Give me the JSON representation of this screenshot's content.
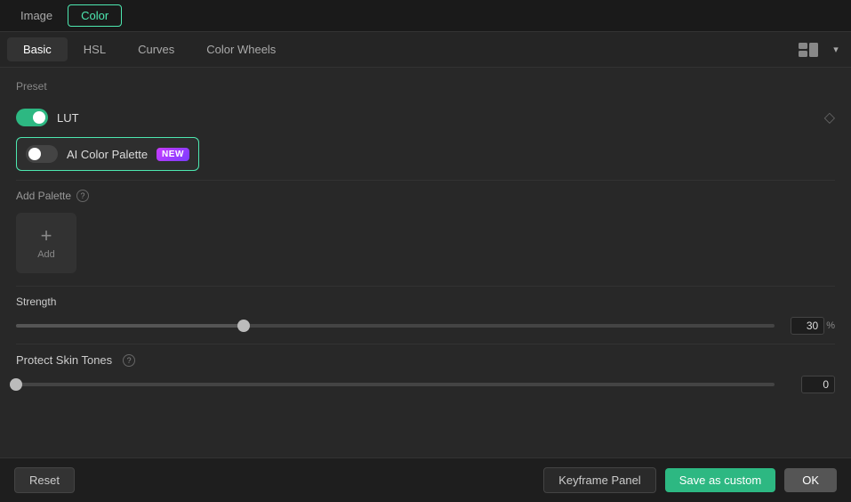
{
  "top_tabs": {
    "items": [
      {
        "id": "image",
        "label": "Image",
        "active": false
      },
      {
        "id": "color",
        "label": "Color",
        "active": true
      }
    ]
  },
  "sec_tabs": {
    "items": [
      {
        "id": "basic",
        "label": "Basic",
        "active": true
      },
      {
        "id": "hsl",
        "label": "HSL",
        "active": false
      },
      {
        "id": "curves",
        "label": "Curves",
        "active": false
      },
      {
        "id": "color_wheels",
        "label": "Color Wheels",
        "active": false
      }
    ]
  },
  "preset": {
    "section_title": "Preset",
    "lut": {
      "label": "LUT",
      "enabled": true
    },
    "ai_color_palette": {
      "label": "AI Color Palette",
      "badge": "NEW",
      "enabled": false
    }
  },
  "add_palette": {
    "label": "Add Palette",
    "help_tooltip": "?",
    "add_button_label": "Add"
  },
  "strength": {
    "label": "Strength",
    "value": "30",
    "unit": "%",
    "slider_percent": 30
  },
  "protect_skin_tones": {
    "label": "Protect Skin Tones",
    "help_tooltip": "?",
    "value": "0",
    "slider_percent": 0
  },
  "bottom_bar": {
    "reset_label": "Reset",
    "keyframe_label": "Keyframe Panel",
    "save_custom_label": "Save as custom",
    "ok_label": "OK"
  }
}
